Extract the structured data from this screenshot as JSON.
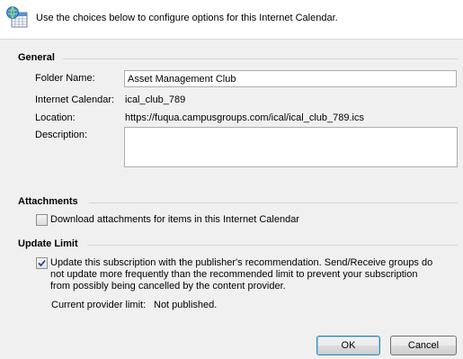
{
  "header": {
    "icon": "internet-calendar-icon",
    "instruction": "Use the choices below to configure options for this Internet Calendar."
  },
  "general": {
    "title": "General",
    "folder_name_label": "Folder Name:",
    "folder_name_value": "Asset Management Club",
    "internet_calendar_label": "Internet Calendar:",
    "internet_calendar_value": "ical_club_789",
    "location_label": "Location:",
    "location_value": "https://fuqua.campusgroups.com/ical/ical_club_789.ics",
    "description_label": "Description:",
    "description_value": ""
  },
  "attachments": {
    "title": "Attachments",
    "download_label": "Download attachments for items in this Internet Calendar",
    "download_checked": false
  },
  "update_limit": {
    "title": "Update Limit",
    "update_label_line1": "Update this subscription with the publisher's recommendation. Send/Receive groups do",
    "update_label_line2": "not update more frequently than the recommended limit to prevent your subscription",
    "update_label_line3": "from possibly being cancelled by the content provider.",
    "update_checked": true,
    "provider_limit_label": "Current provider limit:",
    "provider_limit_value": "Not published."
  },
  "buttons": {
    "ok_label": "OK",
    "cancel_label": "Cancel"
  },
  "colors": {
    "header_bg": "#ffffff",
    "dialog_bg": "#f0f0f0",
    "default_button_border": "#3c7fb1"
  }
}
